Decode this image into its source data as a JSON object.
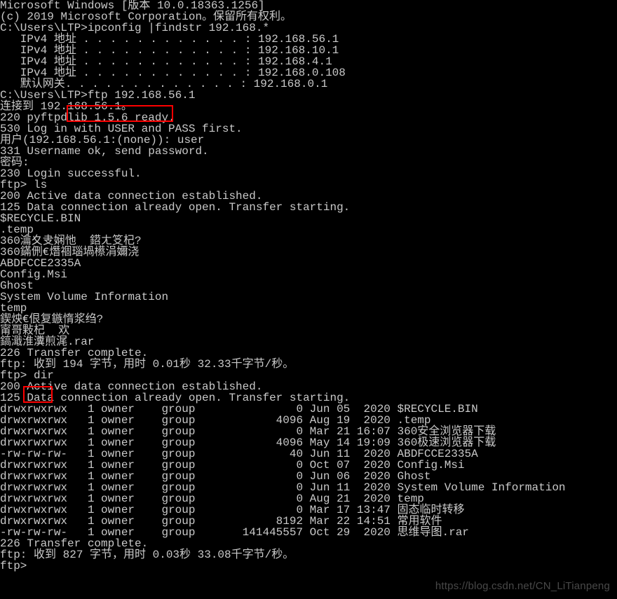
{
  "lines": [
    "Microsoft Windows [版本 10.0.18363.1256]",
    "(c) 2019 Microsoft Corporation。保留所有权利。",
    "",
    "C:\\Users\\LTP>ipconfig |findstr 192.168.*",
    "   IPv4 地址 . . . . . . . . . . . . : 192.168.56.1",
    "   IPv4 地址 . . . . . . . . . . . . : 192.168.10.1",
    "   IPv4 地址 . . . . . . . . . . . . : 192.168.4.1",
    "   IPv4 地址 . . . . . . . . . . . . : 192.168.0.108",
    "   默认网关. . . . . . . . . . . . . : 192.168.0.1",
    "",
    "C:\\Users\\LTP>ftp 192.168.56.1",
    "连接到 192.168.56.1。",
    "220 pyftpdlib 1.5.6 ready.",
    "530 Log in with USER and PASS first.",
    "用户(192.168.56.1:(none)): user",
    "331 Username ok, send password.",
    "密码:",
    "230 Login successful.",
    "ftp> ls",
    "200 Active data connection established.",
    "125 Data connection already open. Transfer starting.",
    "$RECYCLE.BIN",
    ".temp",
    "360瀹夊叏娴忚  鍣ㄤ笅杞?",
    "360鏋侀€熸祻瑙堝櫒涓嬭浇",
    "ABDFCCE2335A",
    "Config.Msi",
    "Ghost",
    "System Volume Information",
    "temp",
    "鍥炴€佷复鏃惰浆绉?",
    "甯哥敤杞  欢",
    "鎬濈淮瀵煎浘.rar",
    "226 Transfer complete.",
    "ftp: 收到 194 字节，用时 0.01秒 32.33千字节/秒。",
    "ftp> dir",
    "200 Active data connection established.",
    "125 Data connection already open. Transfer starting.",
    "drwxrwxrwx   1 owner    group               0 Jun 05  2020 $RECYCLE.BIN",
    "drwxrwxrwx   1 owner    group            4096 Aug 19  2020 .temp",
    "drwxrwxrwx   1 owner    group               0 Mar 21 16:07 360安全浏览器下载",
    "drwxrwxrwx   1 owner    group            4096 May 14 19:09 360极速浏览器下载",
    "-rw-rw-rw-   1 owner    group              40 Jun 11  2020 ABDFCCE2335A",
    "drwxrwxrwx   1 owner    group               0 Oct 07  2020 Config.Msi",
    "drwxrwxrwx   1 owner    group               0 Jun 06  2020 Ghost",
    "drwxrwxrwx   1 owner    group               0 Jun 11  2020 System Volume Information",
    "drwxrwxrwx   1 owner    group               0 Aug 21  2020 temp",
    "drwxrwxrwx   1 owner    group               0 Mar 17 13:47 固态临时转移",
    "drwxrwxrwx   1 owner    group            8192 Mar 22 14:51 常用软件",
    "-rw-rw-rw-   1 owner    group       141445557 Oct 29  2020 思维导图.rar",
    "226 Transfer complete.",
    "ftp: 收到 827 字节，用时 0.03秒 33.08千字节/秒。",
    "ftp>"
  ],
  "watermark": "https://blog.csdn.net/CN_LiTianpeng",
  "highlights": {
    "hl1_label": "ftp-command-highlight",
    "hl2_label": "dir-command-highlight"
  }
}
